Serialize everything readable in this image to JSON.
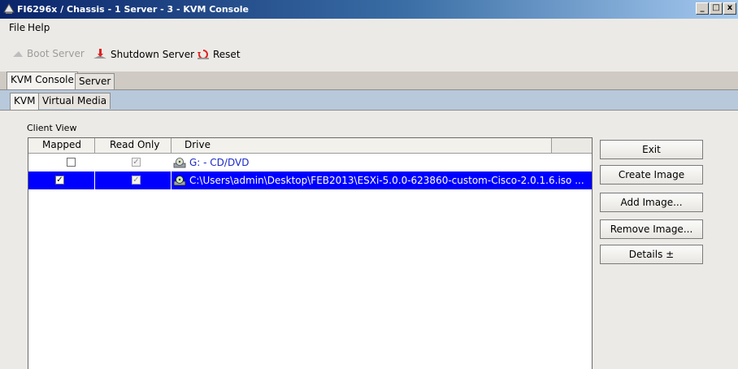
{
  "window": {
    "title": "FI6296x / Chassis - 1 Server - 3 - KVM Console",
    "controls": [
      "_",
      "□",
      "x"
    ]
  },
  "menu": {
    "items": [
      "File",
      "Help"
    ]
  },
  "toolbar": {
    "boot_server": "Boot Server",
    "shutdown_server": "Shutdown Server",
    "reset": "Reset"
  },
  "tabs": {
    "top": [
      "KVM Console",
      "Server"
    ],
    "sub": [
      "KVM",
      "Virtual Media"
    ]
  },
  "client_view": {
    "label": "Client View",
    "columns": [
      "Mapped",
      "Read Only",
      "Drive"
    ],
    "rows": [
      {
        "mapped": false,
        "read_only": true,
        "drive": "G: - CD/DVD",
        "selected": false
      },
      {
        "mapped": true,
        "read_only": true,
        "drive": "C:\\Users\\admin\\Desktop\\FEB2013\\ESXi-5.0.0-623860-custom-Cisco-2.0.1.6.iso ...",
        "selected": true
      }
    ]
  },
  "buttons": {
    "exit": "Exit",
    "create_image": "Create Image",
    "add_image": "Add Image...",
    "remove_image": "Remove Image...",
    "details": "Details ±"
  },
  "colors": {
    "selection": "#0000ff",
    "title_start": "#0a246a",
    "title_end": "#a6caf0"
  }
}
